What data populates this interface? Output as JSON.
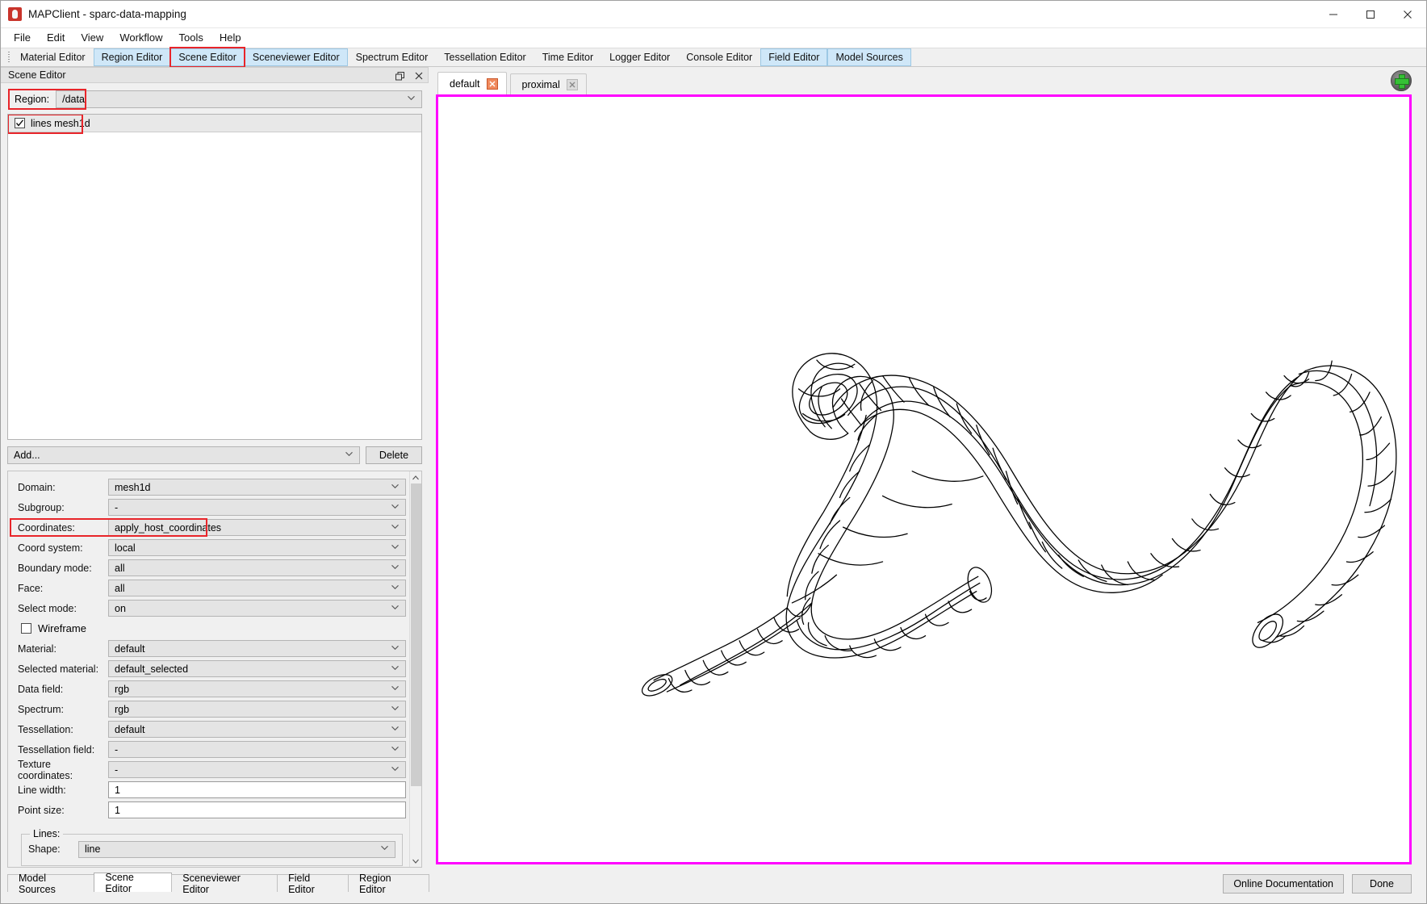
{
  "window": {
    "title": "MAPClient - sparc-data-mapping",
    "app_icon": "mapclient-icon",
    "minimize": "─",
    "maximize": "☐",
    "close": "✕"
  },
  "menubar": {
    "items": [
      "File",
      "Edit",
      "View",
      "Workflow",
      "Tools",
      "Help"
    ]
  },
  "editor_tabs": {
    "items": [
      {
        "label": "Material Editor",
        "highlighted": false,
        "outlined": false
      },
      {
        "label": "Region Editor",
        "highlighted": true,
        "outlined": false
      },
      {
        "label": "Scene Editor",
        "highlighted": true,
        "outlined": true
      },
      {
        "label": "Sceneviewer Editor",
        "highlighted": true,
        "outlined": false
      },
      {
        "label": "Spectrum Editor",
        "highlighted": false,
        "outlined": false
      },
      {
        "label": "Tessellation Editor",
        "highlighted": false,
        "outlined": false
      },
      {
        "label": "Time Editor",
        "highlighted": false,
        "outlined": false
      },
      {
        "label": "Logger Editor",
        "highlighted": false,
        "outlined": false
      },
      {
        "label": "Console Editor",
        "highlighted": false,
        "outlined": false
      },
      {
        "label": "Field Editor",
        "highlighted": true,
        "outlined": false
      },
      {
        "label": "Model Sources",
        "highlighted": true,
        "outlined": false
      }
    ]
  },
  "scene_editor": {
    "dock_title": "Scene Editor",
    "float_icon": "restore-icon",
    "close_icon": "close-icon",
    "region": {
      "label": "Region:",
      "value": "/data",
      "outlined": true
    },
    "graphics_list": [
      {
        "label": "lines mesh1d",
        "checked": true,
        "outlined": true
      }
    ],
    "add_combo": {
      "value": "Add...",
      "placeholder": "Add..."
    },
    "delete_button": "Delete",
    "properties": [
      {
        "label": "Domain:",
        "value": "mesh1d",
        "type": "combo",
        "outlined": false
      },
      {
        "label": "Subgroup:",
        "value": "-",
        "type": "combo",
        "outlined": false
      },
      {
        "label": "Coordinates:",
        "value": "apply_host_coordinates",
        "type": "combo",
        "outlined": true
      },
      {
        "label": "Coord system:",
        "value": "local",
        "type": "combo",
        "outlined": false
      },
      {
        "label": "Boundary mode:",
        "value": "all",
        "type": "combo",
        "outlined": false
      },
      {
        "label": "Face:",
        "value": "all",
        "type": "combo",
        "outlined": false
      },
      {
        "label": "Select mode:",
        "value": "on",
        "type": "combo",
        "outlined": false
      }
    ],
    "wireframe": {
      "label": "Wireframe",
      "checked": false
    },
    "properties2": [
      {
        "label": "Material:",
        "value": "default",
        "type": "combo"
      },
      {
        "label": "Selected material:",
        "value": "default_selected",
        "type": "combo"
      },
      {
        "label": "Data field:",
        "value": "rgb",
        "type": "combo"
      },
      {
        "label": "Spectrum:",
        "value": "rgb",
        "type": "combo"
      },
      {
        "label": "Tessellation:",
        "value": "default",
        "type": "combo"
      },
      {
        "label": "Tessellation field:",
        "value": "-",
        "type": "combo"
      },
      {
        "label": "Texture coordinates:",
        "value": "-",
        "type": "combo"
      },
      {
        "label": "Line width:",
        "value": "1",
        "type": "text"
      },
      {
        "label": "Point size:",
        "value": "1",
        "type": "text"
      }
    ],
    "lines_group": {
      "legend": "Lines:",
      "shape": {
        "label": "Shape:",
        "value": "line"
      }
    }
  },
  "bottom_dock_tabs": {
    "items": [
      {
        "label": "Model Sources",
        "active": false
      },
      {
        "label": "Scene Editor",
        "active": true
      },
      {
        "label": "Sceneviewer Editor",
        "active": false
      },
      {
        "label": "Field Editor",
        "active": false
      },
      {
        "label": "Region Editor",
        "active": false
      }
    ]
  },
  "viewer": {
    "tabs": [
      {
        "label": "default",
        "active": true,
        "close_icon": "close-icon",
        "close_style": "red"
      },
      {
        "label": "proximal",
        "active": false,
        "close_icon": "close-icon",
        "close_style": "grey"
      }
    ],
    "add_button": {
      "icon": "plus-icon",
      "title": "add-view"
    },
    "border_color": "#ff00ff",
    "scene": {
      "description": "wireframe-tubular-mesh",
      "line_color": "#000000",
      "background": "#ffffff"
    }
  },
  "footer": {
    "online_documentation": "Online Documentation",
    "done": "Done"
  },
  "colors": {
    "highlight_tab": "#cfe7f8",
    "red_annotation": "#e8252a",
    "magenta_border": "#ff00ff",
    "window_bg": "#f0f0f0"
  }
}
